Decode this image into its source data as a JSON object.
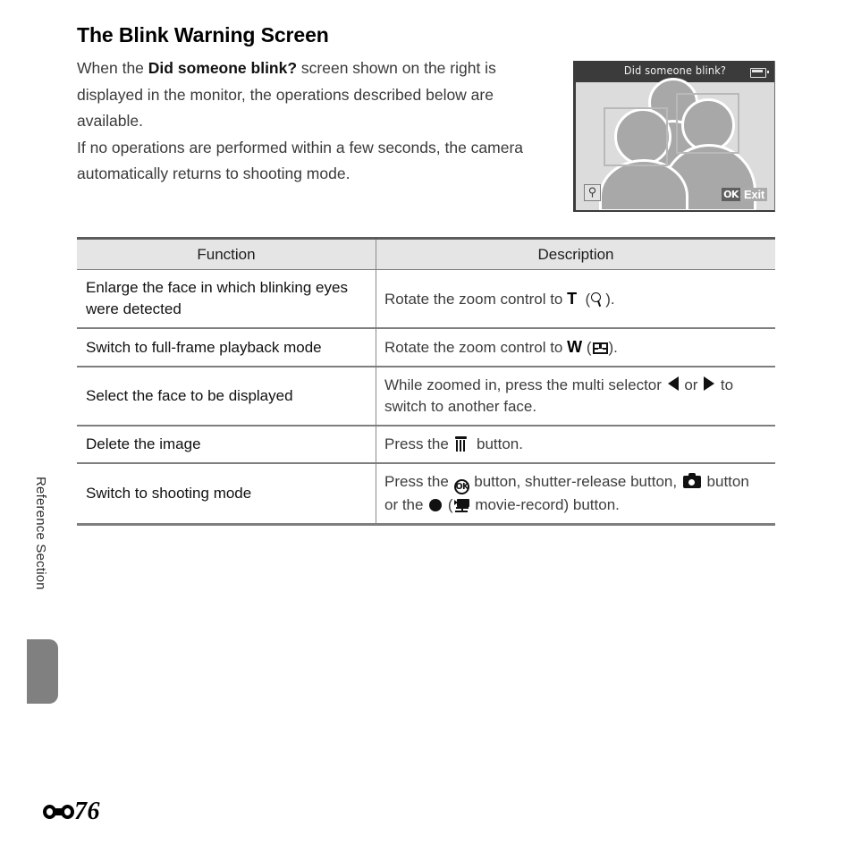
{
  "page": {
    "heading": "The Blink Warning Screen",
    "side_tab_label": "Reference Section",
    "page_number": "76",
    "page_number_mark": "reference-section-bone-mark"
  },
  "intro": {
    "para1_before_bold": "When the ",
    "para1_bold": "Did someone blink?",
    "para1_after_bold": " screen shown on the right is displayed in the monitor, the operations described below are available.",
    "para2": "If no operations are performed within a few seconds, the camera automatically returns to shooting mode."
  },
  "monitor": {
    "title": "Did someone blink?",
    "battery_icon": "battery-icon",
    "magnify_badge_icon": "magnifier-icon",
    "exit_ok_label": "OK",
    "exit_label": "Exit",
    "scene_description": "three-people-photo-with-face-detection-boxes"
  },
  "table": {
    "headers": [
      "Function",
      "Description"
    ],
    "rows": [
      {
        "function": "Enlarge the face in which blinking eyes were detected",
        "description_parts": [
          {
            "type": "text",
            "value": "Rotate the zoom control to "
          },
          {
            "type": "bold",
            "value": "T"
          },
          {
            "type": "text",
            "value": "  ("
          },
          {
            "type": "icon",
            "value": "magnifier-icon"
          },
          {
            "type": "text",
            "value": ")."
          }
        ]
      },
      {
        "function": "Switch to full-frame playback mode",
        "description_parts": [
          {
            "type": "text",
            "value": "Rotate the zoom control to "
          },
          {
            "type": "bold",
            "value": "W"
          },
          {
            "type": "text",
            "value": " ("
          },
          {
            "type": "icon",
            "value": "thumbnail-grid-icon"
          },
          {
            "type": "text",
            "value": ")."
          }
        ]
      },
      {
        "function": "Select the face to be displayed",
        "description_parts": [
          {
            "type": "text",
            "value": "While zoomed in, press the multi selector "
          },
          {
            "type": "icon",
            "value": "triangle-left-icon"
          },
          {
            "type": "text",
            "value": " or "
          },
          {
            "type": "icon",
            "value": "triangle-right-icon"
          },
          {
            "type": "text",
            "value": " to switch to another face."
          }
        ]
      },
      {
        "function": "Delete the image",
        "description_parts": [
          {
            "type": "text",
            "value": "Press the "
          },
          {
            "type": "icon",
            "value": "trash-icon"
          },
          {
            "type": "text",
            "value": "  button."
          }
        ]
      },
      {
        "function": "Switch to shooting mode",
        "description_parts": [
          {
            "type": "text",
            "value": "Press the "
          },
          {
            "type": "icon",
            "value": "ok-button-icon"
          },
          {
            "type": "text",
            "value": " button, shutter-release button, "
          },
          {
            "type": "icon",
            "value": "camera-icon"
          },
          {
            "type": "text",
            "value": " button or the "
          },
          {
            "type": "icon",
            "value": "record-dot-icon"
          },
          {
            "type": "text",
            "value": " ("
          },
          {
            "type": "icon",
            "value": "movie-camera-icon"
          },
          {
            "type": "text",
            "value": " movie-record) button."
          }
        ]
      }
    ]
  }
}
